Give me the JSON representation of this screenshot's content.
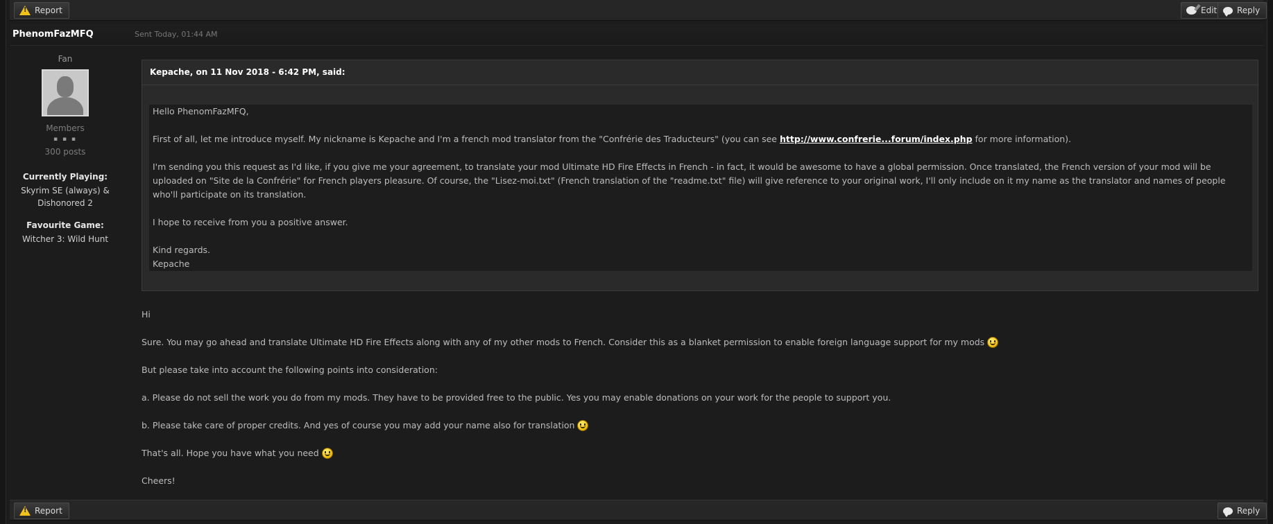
{
  "top_bar": {
    "report_label": "Report",
    "edit_label": "Edit",
    "reply_label": "Reply"
  },
  "post": {
    "username": "PhenomFazMFQ",
    "sent": "Sent Today, 01:44 AM"
  },
  "author": {
    "rank": "Fan",
    "group": "Members",
    "pips": "▪ ▪ ▪",
    "posts": "300 posts",
    "fields": [
      {
        "label": "Currently Playing:",
        "value_line1": "Skyrim SE (always) &",
        "value_line2": "Dishonored 2"
      },
      {
        "label": "Favourite Game:",
        "value_line1": "Witcher 3: Wild Hunt",
        "value_line2": ""
      }
    ]
  },
  "quote": {
    "citation": "Kepache, on 11 Nov 2018 - 6:42 PM, said:",
    "greeting": "Hello PhenomFazMFQ,",
    "p1_before": "First of all, let me introduce myself. My nickname is Kepache and I'm a french mod translator from the \"Confrérie des Traducteurs\" (you can see ",
    "p1_link": "http://www.confrerie...forum/index.php",
    "p1_after": " for more information).",
    "p2": "I'm sending you this request as I'd like, if you give me your agreement, to translate your mod Ultimate HD Fire Effects in French - in fact, it would be awesome to have a global permission. Once translated, the French version of your mod will be uploaded on \"Site de la Confrérie\" for French players pleasure. Of course, the \"Lisez-moi.txt\" (French translation of the \"readme.txt\" file) will give reference to your original work, I'll only include on it my name as the translator and names of people who'll participate on its translation.",
    "p3": "I hope to receive from you a positive answer.",
    "closing": "Kind regards.",
    "signature": "Kepache"
  },
  "reply": {
    "p1": "Hi",
    "p2": "Sure. You may go ahead and translate Ultimate HD Fire Effects along with any of my other mods to French. Consider this as a blanket permission to enable foreign language support for my mods",
    "p3": "But please take into account the following points into consideration:",
    "p4": "a. Please do not sell the work you do from my mods. They have to be provided free to the public. Yes you may enable donations on your work for the people to support you.",
    "p5": "b. Please take care of proper credits. And yes of course you may add your name also for translation",
    "p6": "That's all. Hope you have what you need",
    "p7": "Cheers!"
  },
  "bottom_bar": {
    "report_label": "Report",
    "reply_label": "Reply"
  },
  "colors": {
    "background": "#1c1c1c",
    "quote_bg": "#2a2a2a",
    "warning_yellow": "#f2c21b"
  }
}
